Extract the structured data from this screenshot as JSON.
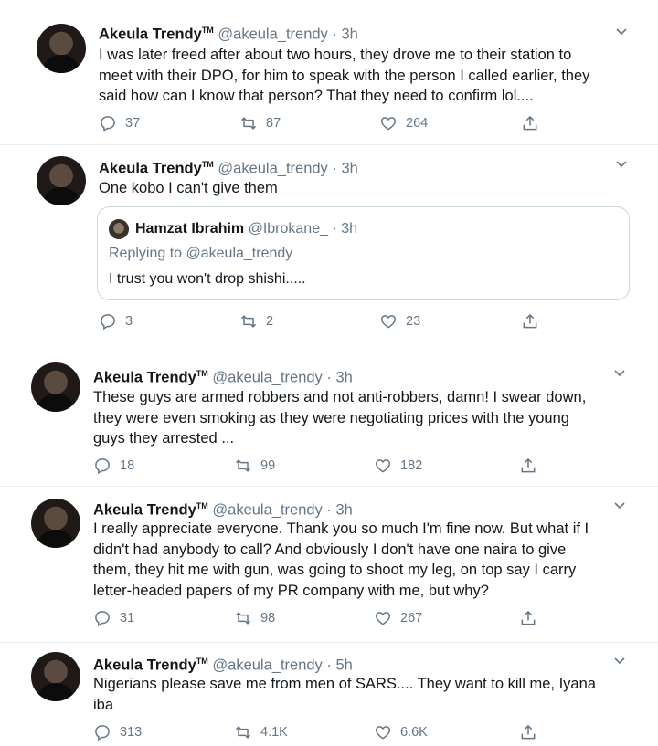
{
  "tweets": [
    {
      "name": "Akeula Trendy",
      "tm": "TM",
      "handle": "@akeula_trendy",
      "dot": "·",
      "time": "3h",
      "text": "I was later freed after about two hours, they drove me to their station to\nmeet with their DPO, for him to speak with the person I called earlier, they\nsaid how can I know that person? That they need to confirm lol....",
      "replies": "37",
      "retweets": "87",
      "likes": "264"
    },
    {
      "name": "Akeula Trendy",
      "tm": "TM",
      "handle": "@akeula_trendy",
      "dot": "·",
      "time": "3h",
      "text": "One kobo I can't give them",
      "quote": {
        "name": "Hamzat Ibrahim",
        "handle": "@Ibrokane_",
        "dot": "·",
        "time": "3h",
        "replying_prefix": "Replying to",
        "replying_to": "@akeula_trendy",
        "text": "I trust you won't drop shishi....."
      },
      "replies": "3",
      "retweets": "2",
      "likes": "23"
    },
    {
      "name": "Akeula Trendy",
      "tm": "TM",
      "handle": "@akeula_trendy",
      "dot": "·",
      "time": "3h",
      "text": "These guys are armed robbers and not anti-robbers, damn! I swear down,\nthey were even smoking as they were negotiating prices with the young\nguys they arrested ...",
      "replies": "18",
      "retweets": "99",
      "likes": "182"
    },
    {
      "name": "Akeula Trendy",
      "tm": "TM",
      "handle": "@akeula_trendy",
      "dot": "·",
      "time": "3h",
      "text": "I really appreciate everyone. Thank you so much I'm fine now. But what if I\ndidn't had anybody to call? And obviously I don't have one naira to give\nthem, they hit me with gun, was going to shoot my leg, on top say I carry\nletter-headed papers of my PR company with me, but why?",
      "replies": "31",
      "retweets": "98",
      "likes": "267"
    },
    {
      "name": "Akeula Trendy",
      "tm": "TM",
      "handle": "@akeula_trendy",
      "dot": "·",
      "time": "5h",
      "text": "Nigerians please save me from men of SARS.... They want to kill me, Iyana\niba",
      "replies": "313",
      "retweets": "4.1K",
      "likes": "6.6K"
    }
  ],
  "icons": {
    "reply": "reply-icon",
    "retweet": "retweet-icon",
    "like": "heart-icon",
    "share": "share-icon",
    "more": "chevron-down-icon"
  },
  "colors": {
    "text": "#14171a",
    "secondary": "#657786",
    "divider": "#e6ecf0",
    "quote_border": "#ccd6dd"
  }
}
